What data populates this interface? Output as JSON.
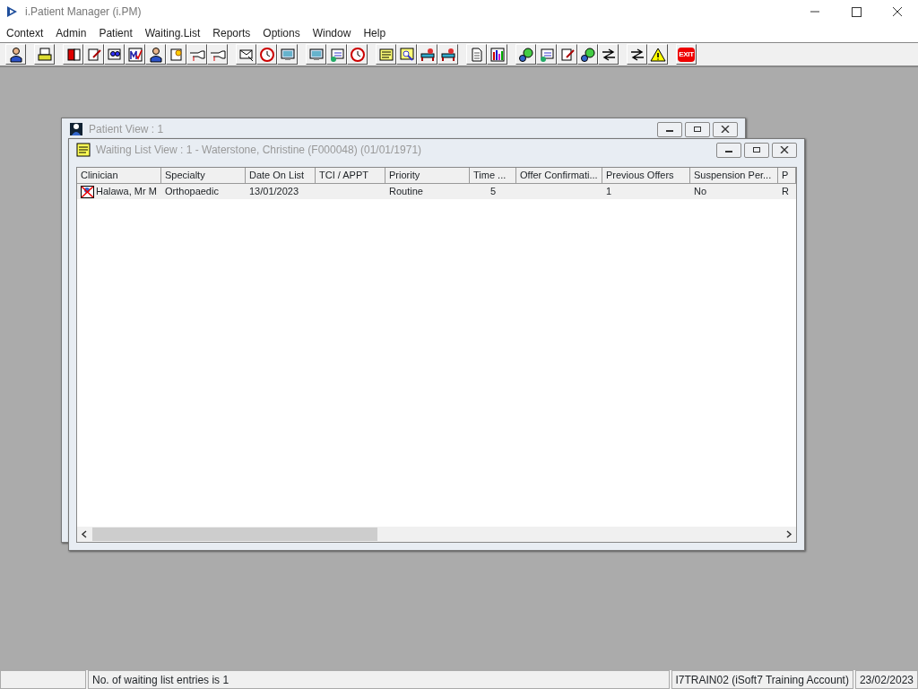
{
  "window": {
    "title": "i.Patient Manager (i.PM)"
  },
  "menu": [
    "Context",
    "Admin",
    "Patient",
    "Waiting.List",
    "Reports",
    "Options",
    "Window",
    "Help"
  ],
  "toolbar": [
    [
      {
        "kind": "person"
      }
    ],
    [
      {
        "kind": "printer"
      }
    ],
    [
      {
        "kind": "book"
      },
      {
        "kind": "pen"
      },
      {
        "kind": "glasses"
      },
      {
        "kind": "tick"
      },
      {
        "kind": "person"
      },
      {
        "kind": "star"
      },
      {
        "kind": "hand"
      },
      {
        "kind": "hand"
      }
    ],
    [
      {
        "kind": "envelope"
      },
      {
        "kind": "clock"
      },
      {
        "kind": "monitor"
      }
    ],
    [
      {
        "kind": "monitor"
      },
      {
        "kind": "card"
      },
      {
        "kind": "clock"
      }
    ],
    [
      {
        "kind": "note"
      },
      {
        "kind": "search"
      },
      {
        "kind": "bed"
      },
      {
        "kind": "bed"
      }
    ],
    [
      {
        "kind": "doc"
      },
      {
        "kind": "chart"
      }
    ],
    [
      {
        "kind": "globe"
      },
      {
        "kind": "card"
      },
      {
        "kind": "pen"
      },
      {
        "kind": "globe"
      },
      {
        "kind": "arrows"
      }
    ],
    [
      {
        "kind": "arrows"
      },
      {
        "kind": "warning"
      }
    ],
    [
      {
        "kind": "stop",
        "label": "EXIT"
      }
    ]
  ],
  "windows": [
    {
      "title": "Patient View : 1",
      "active": false
    },
    {
      "title": "Waiting List View :  1 - Waterstone, Christine (F000048) (01/01/1971)",
      "active": false,
      "table": {
        "columns": [
          "Clinician",
          "Specialty",
          "Date On List",
          "TCI / APPT",
          "Priority",
          "Time ...",
          "Offer Confirmati...",
          "Previous Offers",
          "Suspension Per...",
          "P"
        ],
        "rows": [
          [
            "Halawa, Mr M",
            "Orthopaedic",
            "13/01/2023",
            "",
            "Routine",
            "5",
            "",
            "1",
            "No",
            "R"
          ]
        ]
      }
    }
  ],
  "status_bar": [
    "No. of waiting list entries is 1",
    "I7TRAIN02 (iSoft7 Training Account)",
    "23/02/2023"
  ]
}
